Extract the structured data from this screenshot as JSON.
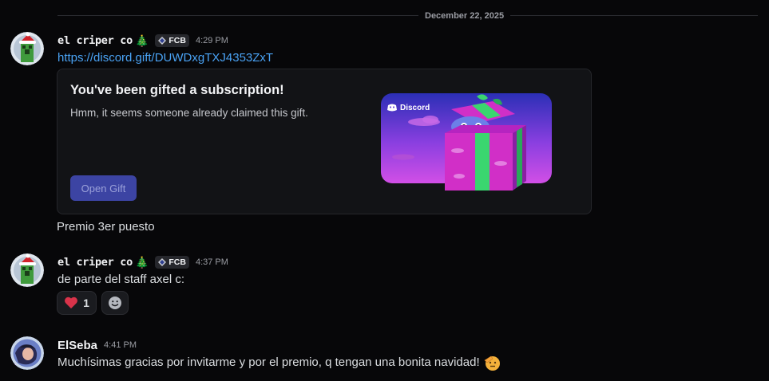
{
  "date_divider": "December 22, 2025",
  "messages": [
    {
      "username": "el criper co",
      "tree": "🎄",
      "tag": "FCB",
      "time": "4:29 PM",
      "link": "https://discord.gift/DUWDxgTXJ4353ZxT",
      "gift": {
        "title": "You've been gifted a subscription!",
        "subtitle": "Hmm, it seems someone already claimed this gift.",
        "button": "Open Gift",
        "brand": "Discord"
      },
      "text": "Premio 3er puesto"
    },
    {
      "username": "el criper co",
      "tree": "🎄",
      "tag": "FCB",
      "time": "4:37 PM",
      "text": "de parte del staff axel c:",
      "reactions": [
        {
          "emoji": "heart",
          "count": "1"
        },
        {
          "emoji": "add-reaction"
        }
      ]
    },
    {
      "username": "ElSeba",
      "time": "4:41 PM",
      "text": "Muchísimas gracias por invitarme y por el premio, q tengan una bonita navidad!"
    }
  ],
  "colors": {
    "background": "#070709",
    "link": "#4aa3f5",
    "blurple": "#3c44a3"
  }
}
